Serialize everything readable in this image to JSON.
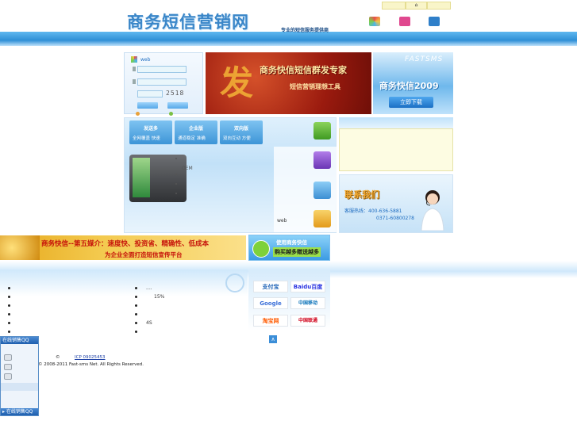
{
  "header": {
    "logo_text": "商务短信营销网",
    "slogan": "专业的短信服务提供商",
    "top_icons": [
      "cube-icon",
      "gift-icon",
      "box-icon"
    ],
    "top_link_glyph": "⌂"
  },
  "login": {
    "web_label": "web",
    "captcha": "2518"
  },
  "banner": {
    "big_glyph": "发",
    "line1": "商务快信短信群发专家",
    "line2": "短信营销理想工具"
  },
  "fastsms": {
    "title": "FASTSMS",
    "product": "商务快信2009",
    "download_button": "立即下载"
  },
  "features": {
    "tabs": [
      {
        "title": "发送多",
        "desc": "全网覆盖 快速"
      },
      {
        "title": "企业版",
        "desc": "通道稳定 准确"
      },
      {
        "title": "双向版",
        "desc": "双向互动 方便"
      }
    ],
    "oem": "OEM",
    "web_label": "web",
    "icons": [
      "sms-icon",
      "network-icon",
      "edit-icon",
      "globe-icon"
    ]
  },
  "contact": {
    "title": "联系我们",
    "hotline": "客服热线：400-636-5881",
    "phone2": "0371-60800278"
  },
  "promo": {
    "line1": "商务快信--第五媒介：速度快、投资省、精确性、低成本",
    "line2": "为企业全面打造短信宣传平台"
  },
  "promo2": {
    "line1": "使用商务快信",
    "line2": "购买越多赠送越多"
  },
  "partners": [
    "支付宝",
    "Baidu百度",
    "Google",
    "中国移动",
    "淘宝网",
    "中国联通"
  ],
  "lists": {
    "left": [
      "",
      "",
      "",
      "",
      "",
      ""
    ],
    "right": [
      "....",
      "15%",
      "",
      "",
      "4S",
      ""
    ]
  },
  "scroll_glyph": "∧",
  "qq": {
    "head": "在线销售QQ",
    "foot": "▸ 在线销售QQ"
  },
  "footer": {
    "copyright_symbol": "©",
    "icp": "ICP 09025453",
    "rights": "© 2008-2011 Fast-sms Net. All Rights Reserved."
  },
  "colors": {
    "brand_blue": "#3a86c8",
    "banner_red": "#9a1a0e",
    "promo_red": "#c6120a"
  }
}
